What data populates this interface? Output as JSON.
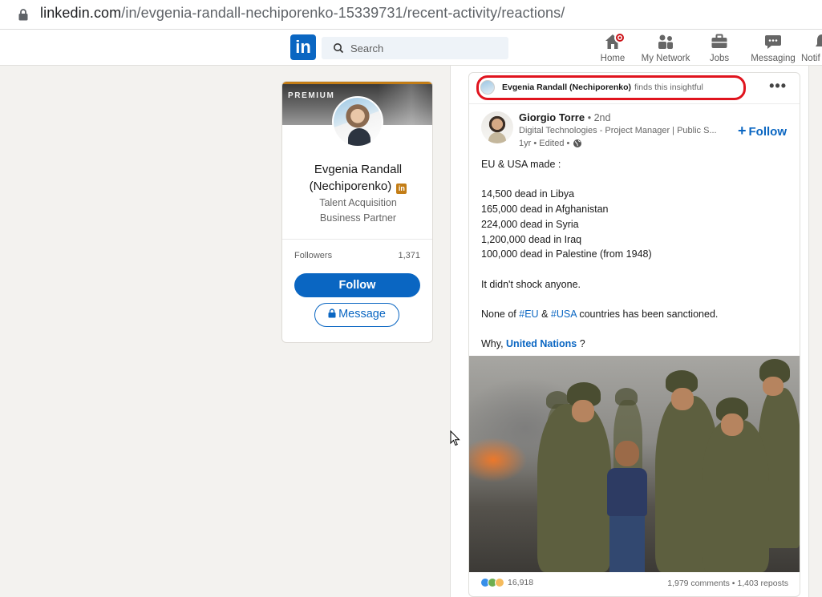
{
  "browser": {
    "url_host": "linkedin.com",
    "url_path": "/in/evgenia-randall-nechiporenko-15339731/recent-activity/reactions/"
  },
  "nav": {
    "logo": "in",
    "search_placeholder": "Search",
    "items": [
      {
        "label": "Home",
        "icon": "home-icon"
      },
      {
        "label": "My Network",
        "icon": "network-icon"
      },
      {
        "label": "Jobs",
        "icon": "briefcase-icon"
      },
      {
        "label": "Messaging",
        "icon": "message-icon"
      },
      {
        "label": "Notif",
        "icon": "bell-icon"
      }
    ]
  },
  "profile": {
    "premium_label": "PREMIUM",
    "name_line1": "Evgenia Randall",
    "name_line2": "(Nechiporenko)",
    "badge": "in",
    "headline_line1": "Talent Acquisition",
    "headline_line2": "Business Partner",
    "followers_label": "Followers",
    "followers_count": "1,371",
    "follow_label": "Follow",
    "message_label": "Message"
  },
  "post": {
    "reactor_name": "Evgenia Randall (Nechiporenko)",
    "reaction_text": "finds this insightful",
    "author_name": "Giorgio Torre",
    "author_degree": "• 2nd",
    "author_headline": "Digital Technologies - Project Manager | Public S...",
    "author_meta": "1yr • Edited •",
    "follow_label": "Follow",
    "body": {
      "intro": "EU & USA made :",
      "lines": [
        "14,500 dead in Libya",
        "165,000 dead in Afghanistan",
        "224,000 dead in Syria",
        "1,200,000 dead in Iraq",
        "100,000 dead in Palestine (from 1948)"
      ],
      "shock": "It didn't shock anyone.",
      "sanction_pre": "None of ",
      "hashtag1": "#EU",
      "sanction_mid": " & ",
      "hashtag2": "#USA",
      "sanction_post": " countries has been sanctioned.",
      "why_pre": "Why, ",
      "mention": "United Nations",
      "why_post": " ?"
    },
    "reaction_count": "16,918",
    "comments_reposts": "1,979 comments • 1,403 reposts"
  },
  "colors": {
    "linkedin_blue": "#0a66c2",
    "premium_gold": "#c37d16",
    "annotation_red": "#e0141e",
    "notification_red": "#cc1016"
  }
}
